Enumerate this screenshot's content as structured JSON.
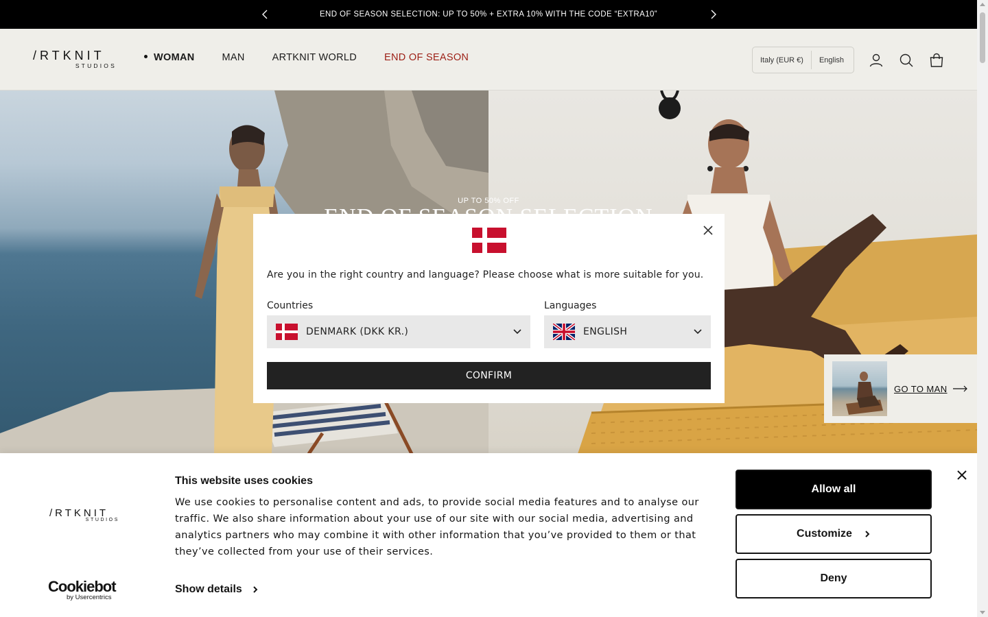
{
  "announcement": {
    "text": "END OF SEASON SELECTION: UP TO 50% + EXTRA 10% WITH THE CODE “EXTRA10”"
  },
  "header": {
    "logo": {
      "word": "/RTKNIT",
      "sub": "STUDIOS"
    },
    "nav": [
      {
        "label": "WOMAN",
        "active": true
      },
      {
        "label": "MAN"
      },
      {
        "label": "ARTKNIT WORLD"
      },
      {
        "label": "END OF SEASON",
        "color": "#9c1e14"
      }
    ],
    "locale": {
      "country": "Italy (EUR €)",
      "language": "English"
    }
  },
  "hero": {
    "eyebrow": "UP TO 50% OFF",
    "title": "END OF SEASON SELECTION",
    "man_card_label": "GO TO MAN"
  },
  "modal": {
    "question": "Are you in the right country and language? Please choose what is more suitable for you.",
    "countries_label": "Countries",
    "languages_label": "Languages",
    "country_value": "DENMARK (DKK KR.)",
    "language_value": "ENGLISH",
    "confirm_label": "CONFIRM",
    "country_flag": "denmark-flag",
    "language_flag": "uk-flag"
  },
  "cookie": {
    "logo": {
      "word": "/RTKNIT",
      "sub": "STUDIOS"
    },
    "title": "This website uses cookies",
    "description": "We use cookies to personalise content and ads, to provide social media features and to analyse our traffic. We also share information about your use of our site with our social media, advertising and analytics partners who may combine it with other information that you’ve provided to them or that they’ve collected from your use of their services.",
    "show_details": "Show details",
    "allow_all": "Allow all",
    "customize": "Customize",
    "deny": "Deny",
    "provider": {
      "name": "Cookiebot",
      "by": "by Usercentrics"
    }
  },
  "colors": {
    "announcement_bg": "#000000",
    "header_bg": "#efeee9",
    "sale_red": "#9c1e14",
    "denmark_red": "#c8102e",
    "confirm_bg": "#222222"
  }
}
